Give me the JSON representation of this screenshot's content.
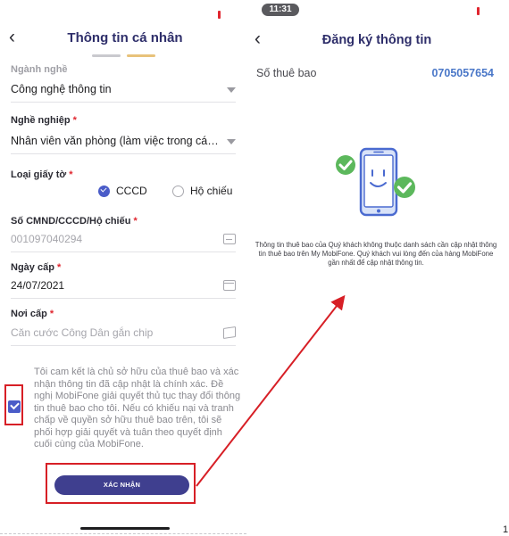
{
  "left": {
    "title": "Thông tin cá nhân",
    "fields": {
      "nganh_nghe": {
        "label": "Ngành nghề",
        "value": "Công nghệ thông tin"
      },
      "nghe_nghiep": {
        "label": "Nghề nghiệp",
        "required_mark": "*",
        "value": "Nhân viên văn phòng (làm việc trong các d..."
      },
      "loai_giay_to": {
        "label": "Loại giấy tờ",
        "required_mark": "*",
        "options": [
          "CCCD",
          "Hộ chiếu"
        ],
        "selected": "CCCD"
      },
      "so_cmnd": {
        "label": "Số CMND/CCCD/Hộ chiếu",
        "required_mark": "*",
        "value": "001097040294"
      },
      "ngay_cap": {
        "label": "Ngày cấp",
        "required_mark": "*",
        "value": "24/07/2021"
      },
      "noi_cap": {
        "label": "Nơi cấp",
        "required_mark": "*",
        "value": "Căn cước Công Dân gắn chip"
      }
    },
    "commitment_text": "Tôi cam kết là chủ sở hữu của thuê bao và xác nhận thông tin đã cập nhật là chính xác. Đề nghị MobiFone giải quyết thủ tục thay đổi thông tin thuê bao cho tôi. Nếu có khiếu nại và tranh chấp về quyền sở hữu thuê bao trên, tôi sẽ phối hợp giải quyết và tuân theo quyết định cuối cùng của MobiFone.",
    "commitment_checked": true,
    "confirm_label": "XÁC NHẬN"
  },
  "right": {
    "time": "11:31",
    "title": "Đăng ký thông tin",
    "subscriber_label": "Số thuê bao",
    "subscriber_number": "0705057654",
    "info_text": "Thông tin thuê bao của Quý khách không thuộc danh sách cần cập nhật thông tin thuê bao trên My MobiFone. Quý khách vui lòng đến của hàng MobiFone gần nhất để cập nhật thông tin."
  },
  "edge_number": "1",
  "colors": {
    "accent": "#3f3f8f",
    "title": "#2e2e6a",
    "highlight": "#d71f26",
    "link_blue": "#4a77c8",
    "success_green": "#5cb85c"
  },
  "icons": [
    "back-chevron-icon",
    "dropdown-caret-icon",
    "keyboard-icon",
    "calendar-icon",
    "map-icon",
    "phone-check-illustration"
  ]
}
